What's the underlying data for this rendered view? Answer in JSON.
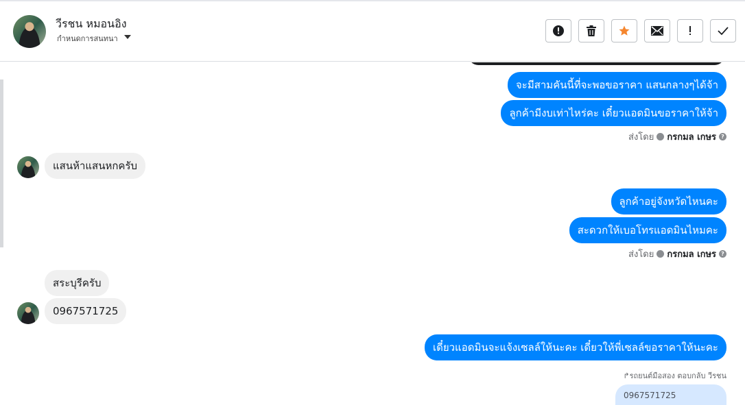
{
  "header": {
    "name": "วีรชน หมอนอิง",
    "conversation_settings": "กำหนดการสนทนา",
    "toolbar": [
      {
        "name": "report-button",
        "icon": "alert-circle-icon"
      },
      {
        "name": "delete-button",
        "icon": "trash-icon"
      },
      {
        "name": "star-button",
        "icon": "star-icon",
        "color": "#f5862e"
      },
      {
        "name": "mark-unread-button",
        "icon": "envelope-icon"
      },
      {
        "name": "important-button",
        "icon": "exclamation-icon"
      },
      {
        "name": "done-button",
        "icon": "check-icon"
      }
    ]
  },
  "messages": {
    "m1": "จะมีสามคันนี้ที่จะพอขอราคา แสนกลางๆได้จ้า",
    "m2": "ลูกค้ามีงบเท่าไหร่คะ เดี๋ยวแอดมินขอราคาให้จ้า",
    "m3": "แสนห้าแสนหกครับ",
    "m4": "ลูกค้าอยู่จังหวัดไหนคะ",
    "m5": "สะดวกให้เบอโทรแอดมินไหมคะ",
    "m6": "สระบุรีครับ",
    "m7": "0967571725",
    "m8": "เดี๋ยวแอดมินจะแจ้งเซลล์ให้นะคะ เดี๋ยวให้พี่เซลล์ขอราคาให้นะคะ"
  },
  "sent_by": {
    "prefix": "ส่งโดย",
    "name": "กรกมล เกษร"
  },
  "reply": {
    "label": "รถยนต์มือสอง ตอบกลับ วีรชน",
    "quoted": "0967571725"
  },
  "colors": {
    "outgoing": "#0084ff",
    "incoming": "#f0f0f0",
    "star": "#f5862e"
  }
}
